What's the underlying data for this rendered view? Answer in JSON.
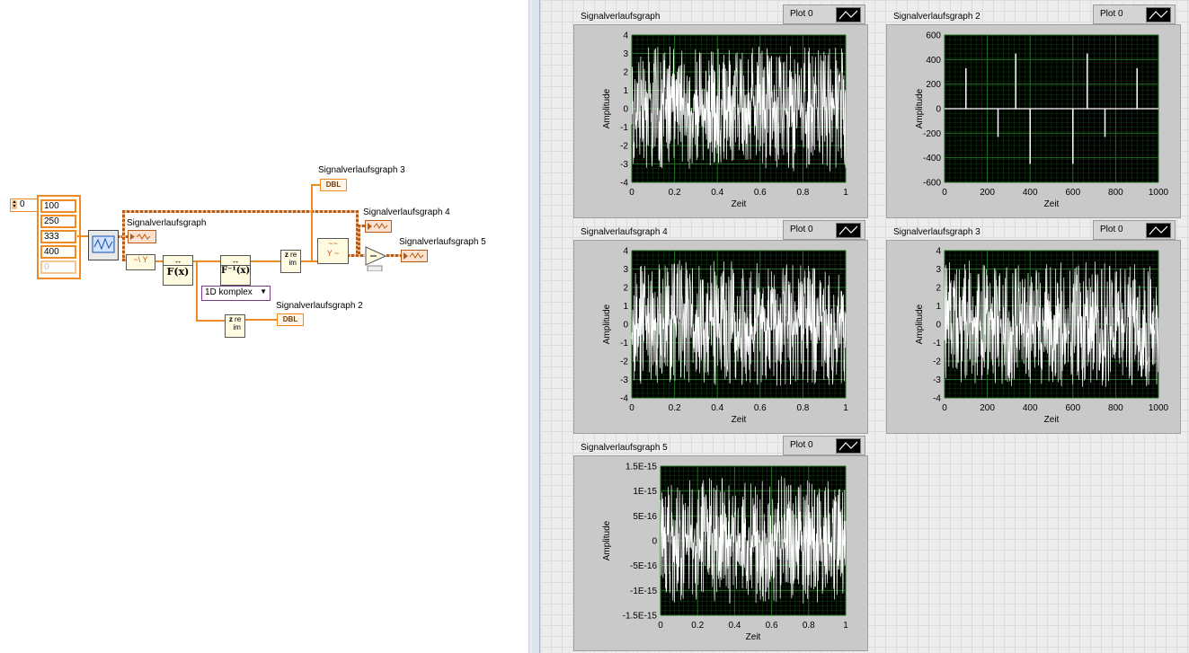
{
  "block_diagram": {
    "array_index": "0",
    "array_values": [
      "100",
      "250",
      "333",
      "400",
      "0"
    ],
    "labels": {
      "graph1": "Signalverlaufsgraph",
      "graph2": "Signalverlaufsgraph 2",
      "graph3": "Signalverlaufsgraph 3",
      "graph4": "Signalverlaufsgraph 4",
      "graph5": "Signalverlaufsgraph 5"
    },
    "dbl_terminal": "DBL",
    "fft_label": "F(x)",
    "ifft_label": "F⁻¹(x)",
    "cx_label": "re\nim",
    "dropdown_value": "1D komplex"
  },
  "front_panel": {
    "graphs": [
      {
        "id": "g1",
        "title": "Signalverlaufsgraph",
        "legend": "Plot 0",
        "xlabel": "Zeit",
        "ylabel": "Amplitude",
        "yticks": [
          "4",
          "3",
          "2",
          "1",
          "0",
          "-1",
          "-2",
          "-3",
          "-4"
        ],
        "xticks": [
          "0",
          "0.2",
          "0.4",
          "0.6",
          "0.8",
          "1"
        ]
      },
      {
        "id": "g2",
        "title": "Signalverlaufsgraph 2",
        "legend": "Plot 0",
        "xlabel": "Zeit",
        "ylabel": "Amplitude",
        "yticks": [
          "600",
          "400",
          "200",
          "0",
          "-200",
          "-400",
          "-600"
        ],
        "xticks": [
          "0",
          "200",
          "400",
          "600",
          "800",
          "1000"
        ]
      },
      {
        "id": "g4",
        "title": "Signalverlaufsgraph 4",
        "legend": "Plot 0",
        "xlabel": "Zeit",
        "ylabel": "Amplitude",
        "yticks": [
          "4",
          "3",
          "2",
          "1",
          "0",
          "-1",
          "-2",
          "-3",
          "-4"
        ],
        "xticks": [
          "0",
          "0.2",
          "0.4",
          "0.6",
          "0.8",
          "1"
        ]
      },
      {
        "id": "g3",
        "title": "Signalverlaufsgraph 3",
        "legend": "Plot 0",
        "xlabel": "Zeit",
        "ylabel": "Amplitude",
        "yticks": [
          "4",
          "3",
          "2",
          "1",
          "0",
          "-1",
          "-2",
          "-3",
          "-4"
        ],
        "xticks": [
          "0",
          "200",
          "400",
          "600",
          "800",
          "1000"
        ]
      },
      {
        "id": "g5",
        "title": "Signalverlaufsgraph 5",
        "legend": "Plot 0",
        "xlabel": "Zeit",
        "ylabel": "Amplitude",
        "yticks": [
          "1.5E-15",
          "1E-15",
          "5E-16",
          "0",
          "-5E-16",
          "-1E-15",
          "-1.5E-15"
        ],
        "xticks": [
          "0",
          "0.2",
          "0.4",
          "0.6",
          "0.8",
          "1"
        ]
      }
    ]
  },
  "chart_data": [
    {
      "type": "line",
      "title": "Signalverlaufsgraph",
      "xlabel": "Zeit",
      "ylabel": "Amplitude",
      "xlim": [
        0,
        1
      ],
      "ylim": [
        -4,
        4
      ],
      "series": [
        {
          "name": "Plot 0",
          "description_values": {
            "n": 1000,
            "envelope_min": -3.5,
            "envelope_max": 3.5
          }
        }
      ]
    },
    {
      "type": "line",
      "title": "Signalverlaufsgraph 2",
      "xlabel": "Zeit",
      "ylabel": "Amplitude",
      "xlim": [
        0,
        1000
      ],
      "ylim": [
        -600,
        600
      ],
      "series": [
        {
          "name": "Plot 0",
          "spikes": [
            [
              100,
              330
            ],
            [
              250,
              -230
            ],
            [
              333,
              450
            ],
            [
              400,
              -450
            ],
            [
              600,
              -450
            ],
            [
              667,
              450
            ],
            [
              750,
              -230
            ],
            [
              900,
              330
            ]
          ]
        }
      ]
    },
    {
      "type": "line",
      "title": "Signalverlaufsgraph 4",
      "xlabel": "Zeit",
      "ylabel": "Amplitude",
      "xlim": [
        0,
        1
      ],
      "ylim": [
        -4,
        4
      ],
      "series": [
        {
          "name": "Plot 0",
          "description_values": {
            "n": 1000,
            "envelope_min": -3.5,
            "envelope_max": 3.5
          }
        }
      ]
    },
    {
      "type": "line",
      "title": "Signalverlaufsgraph 3",
      "xlabel": "Zeit",
      "ylabel": "Amplitude",
      "xlim": [
        0,
        1000
      ],
      "ylim": [
        -4,
        4
      ],
      "series": [
        {
          "name": "Plot 0",
          "description_values": {
            "n": 1000,
            "envelope_min": -3.5,
            "envelope_max": 3.5
          }
        }
      ]
    },
    {
      "type": "line",
      "title": "Signalverlaufsgraph 5",
      "xlabel": "Zeit",
      "ylabel": "Amplitude",
      "xlim": [
        0,
        1
      ],
      "ylim": [
        -1.5e-15,
        1.5e-15
      ],
      "series": [
        {
          "name": "Plot 0",
          "description_values": {
            "n": 1000,
            "envelope_min": -1.3e-15,
            "envelope_max": 1.3e-15
          }
        }
      ]
    }
  ],
  "colors": {
    "wire": "#f08a24",
    "plot_bg": "#000000",
    "grid": "#1f6e1f",
    "trace": "#ffffff",
    "panel": "#c9c9c9"
  }
}
